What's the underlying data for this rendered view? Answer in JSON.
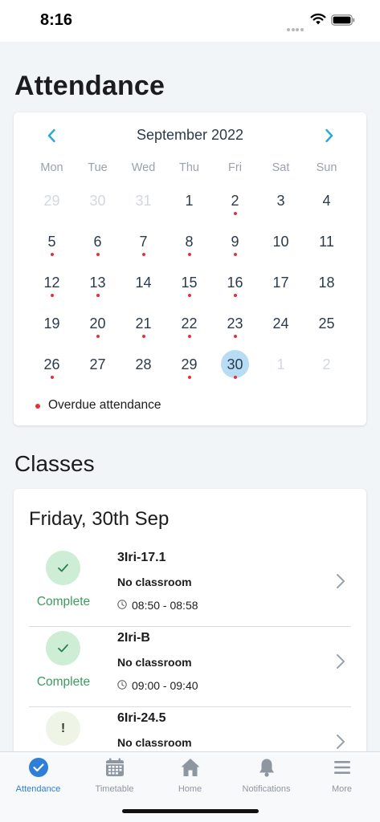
{
  "status_bar": {
    "time": "8:16"
  },
  "page": {
    "title": "Attendance"
  },
  "calendar": {
    "month_label": "September 2022",
    "weekdays": [
      "Mon",
      "Tue",
      "Wed",
      "Thu",
      "Fri",
      "Sat",
      "Sun"
    ],
    "weeks": [
      [
        {
          "day": "29",
          "muted": true,
          "overdue": false
        },
        {
          "day": "30",
          "muted": true,
          "overdue": false
        },
        {
          "day": "31",
          "muted": true,
          "overdue": false
        },
        {
          "day": "1",
          "muted": false,
          "overdue": false
        },
        {
          "day": "2",
          "muted": false,
          "overdue": true
        },
        {
          "day": "3",
          "muted": false,
          "overdue": false
        },
        {
          "day": "4",
          "muted": false,
          "overdue": false
        }
      ],
      [
        {
          "day": "5",
          "muted": false,
          "overdue": true
        },
        {
          "day": "6",
          "muted": false,
          "overdue": true
        },
        {
          "day": "7",
          "muted": false,
          "overdue": true
        },
        {
          "day": "8",
          "muted": false,
          "overdue": true
        },
        {
          "day": "9",
          "muted": false,
          "overdue": true
        },
        {
          "day": "10",
          "muted": false,
          "overdue": false
        },
        {
          "day": "11",
          "muted": false,
          "overdue": false
        }
      ],
      [
        {
          "day": "12",
          "muted": false,
          "overdue": true
        },
        {
          "day": "13",
          "muted": false,
          "overdue": true
        },
        {
          "day": "14",
          "muted": false,
          "overdue": false
        },
        {
          "day": "15",
          "muted": false,
          "overdue": true
        },
        {
          "day": "16",
          "muted": false,
          "overdue": true
        },
        {
          "day": "17",
          "muted": false,
          "overdue": false
        },
        {
          "day": "18",
          "muted": false,
          "overdue": false
        }
      ],
      [
        {
          "day": "19",
          "muted": false,
          "overdue": false
        },
        {
          "day": "20",
          "muted": false,
          "overdue": true
        },
        {
          "day": "21",
          "muted": false,
          "overdue": true
        },
        {
          "day": "22",
          "muted": false,
          "overdue": true
        },
        {
          "day": "23",
          "muted": false,
          "overdue": true
        },
        {
          "day": "24",
          "muted": false,
          "overdue": false
        },
        {
          "day": "25",
          "muted": false,
          "overdue": false
        }
      ],
      [
        {
          "day": "26",
          "muted": false,
          "overdue": true
        },
        {
          "day": "27",
          "muted": false,
          "overdue": false
        },
        {
          "day": "28",
          "muted": false,
          "overdue": false
        },
        {
          "day": "29",
          "muted": false,
          "overdue": true
        },
        {
          "day": "30",
          "muted": false,
          "overdue": true,
          "selected": true
        },
        {
          "day": "1",
          "muted": true,
          "overdue": false
        },
        {
          "day": "2",
          "muted": true,
          "overdue": false
        }
      ]
    ],
    "legend_label": "Overdue attendance"
  },
  "classes": {
    "section_title": "Classes",
    "date_heading": "Friday, 30th Sep",
    "items": [
      {
        "name": "3Iri-17.1",
        "room": "No classroom",
        "time": "08:50 - 08:58",
        "status": "Complete",
        "status_icon": "check-icon"
      },
      {
        "name": "2Iri-B",
        "room": "No classroom",
        "time": "09:00 - 09:40",
        "status": "Complete",
        "status_icon": "check-icon"
      },
      {
        "name": "6Iri-24.5",
        "room": "No classroom",
        "time": "",
        "status": "",
        "status_icon": "exclamation-icon"
      }
    ]
  },
  "tabs": [
    {
      "label": "Attendance",
      "icon": "check-circle-icon",
      "active": true
    },
    {
      "label": "Timetable",
      "icon": "calendar-icon",
      "active": false
    },
    {
      "label": "Home",
      "icon": "home-icon",
      "active": false
    },
    {
      "label": "Notifications",
      "icon": "bell-icon",
      "active": false
    },
    {
      "label": "More",
      "icon": "menu-icon",
      "active": false
    }
  ],
  "colors": {
    "accent": "#2f7ed8",
    "overdue": "#e5303a",
    "complete": "#3c9a5f",
    "selected_day": "#b9dcf5",
    "chevron": "#2aa8d8"
  }
}
